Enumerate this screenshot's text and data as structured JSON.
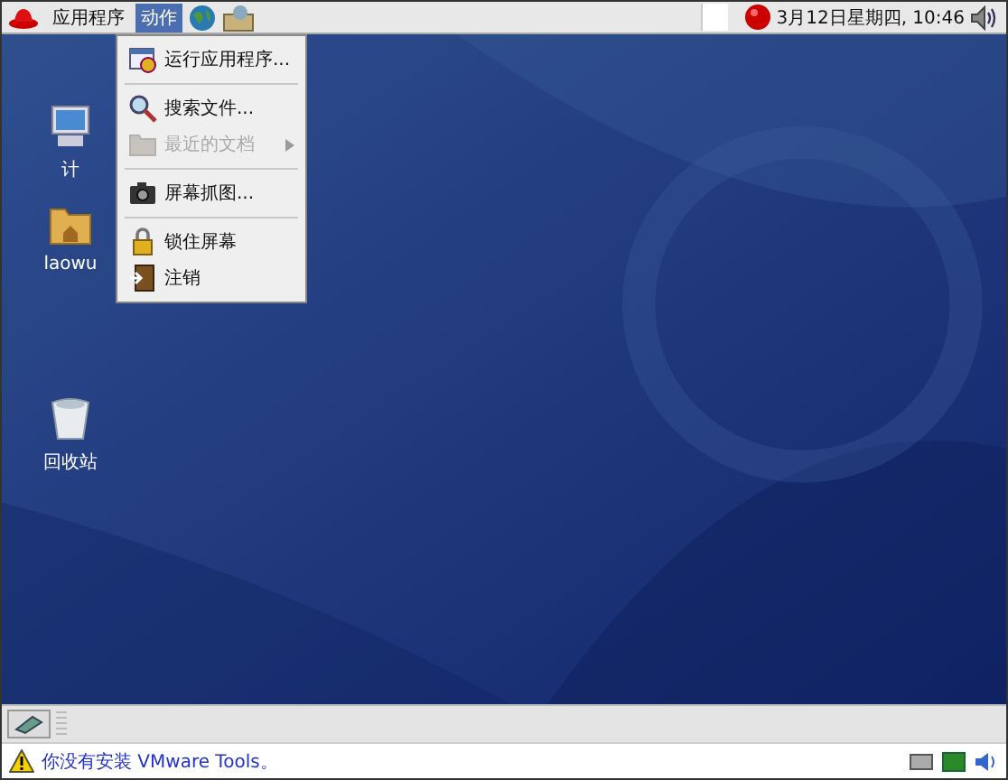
{
  "top_panel": {
    "menus": [
      {
        "label": "应用程序",
        "selected": false
      },
      {
        "label": "动作",
        "selected": true
      }
    ],
    "clock": "3月12日星期四, 10:46"
  },
  "action_menu": {
    "items": [
      {
        "kind": "item",
        "label": "运行应用程序...",
        "disabled": false,
        "submenu": false
      },
      {
        "kind": "separator"
      },
      {
        "kind": "item",
        "label": "搜索文件...",
        "disabled": false,
        "submenu": false
      },
      {
        "kind": "item",
        "label": "最近的文档",
        "disabled": true,
        "submenu": true
      },
      {
        "kind": "separator"
      },
      {
        "kind": "item",
        "label": "屏幕抓图...",
        "disabled": false,
        "submenu": false
      },
      {
        "kind": "separator"
      },
      {
        "kind": "item",
        "label": "锁住屏幕",
        "disabled": false,
        "submenu": false
      },
      {
        "kind": "item",
        "label": "注销",
        "disabled": false,
        "submenu": false
      }
    ]
  },
  "desktop_icons": [
    {
      "kind": "computer",
      "label": "计"
    },
    {
      "kind": "home",
      "label": "laowu"
    },
    {
      "kind": "trash",
      "label": "回收站"
    }
  ],
  "status_bar": {
    "message": "你没有安装 VMware Tools。"
  }
}
